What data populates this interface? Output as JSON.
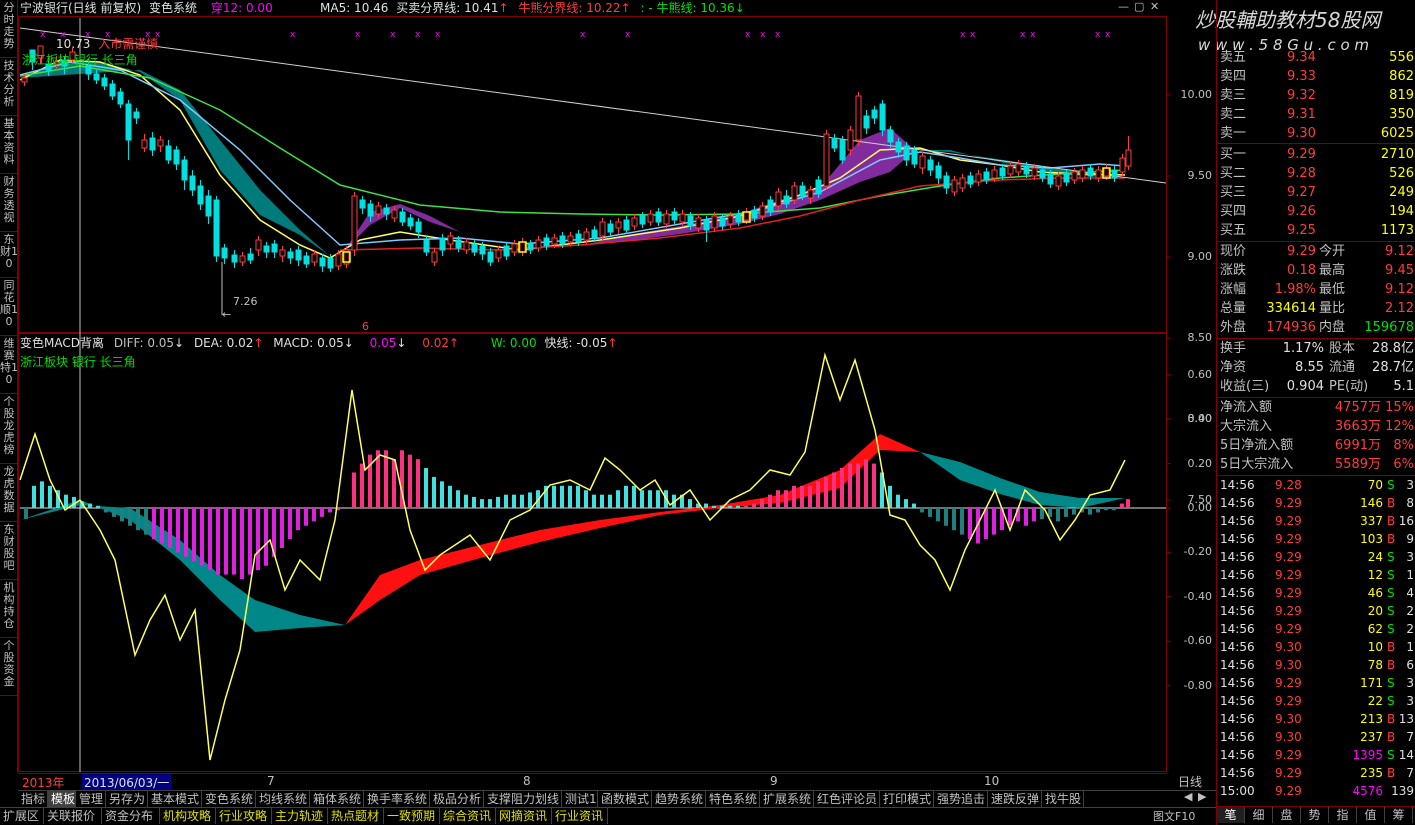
{
  "watermark": {
    "title": "炒股輔助教材58股网",
    "url": "w w w . 5 8 G u . c o m"
  },
  "window": {
    "minimize_glyph": "—",
    "restore_glyph": "▢",
    "close_glyph": "✕"
  },
  "left_tabs": [
    "分时走势",
    "技术分析",
    "基本资料",
    "财务透视",
    "东财10",
    "同花顺10",
    "维赛特10",
    "个股龙虎榜",
    "龙虎数据",
    "东财股吧",
    "机构持仓",
    "个股资金"
  ],
  "main_header": {
    "stock": "宁波银行(日线 前复权)",
    "system": "变色系统",
    "chuan": "穿12: 0.00",
    "ma5": "MA5: 10.46",
    "buysell": "买卖分界线: 10.41",
    "buysell_arrow": "↑",
    "bullbear": "牛熊分界线: 10.22",
    "bullbear_arrow": "↑",
    "bull_prefix": ": -",
    "bull": "牛熊线: 10.36",
    "bull_arrow": "↓"
  },
  "price_chart": {
    "overlay1": "10.73",
    "overlay2": "入市需谨慎",
    "sector": "浙江板块 银行 长三角",
    "low_label": "7.26",
    "axis": [
      {
        "label": "10.00",
        "value": 10.0
      },
      {
        "label": "9.50",
        "value": 9.5
      },
      {
        "label": "9.00",
        "value": 9.0
      },
      {
        "label": "8.50",
        "value": 8.5
      },
      {
        "label": "8.00",
        "value": 8.0
      },
      {
        "label": "7.50",
        "value": 7.5
      }
    ],
    "marker": "6"
  },
  "macd_header": {
    "name": "变色MACD背离",
    "diff": "DIFF: 0.05",
    "diff_arrow": "↓",
    "dea": "DEA: 0.02",
    "dea_arrow": "↑",
    "macd": "MACD: 0.05",
    "macd_arrow": "↓",
    "v1": "0.05",
    "v1_arrow": "↓",
    "v2": "0.02",
    "v2_arrow": "↑",
    "w": "W: 0.00",
    "fast": "快线: -0.05",
    "fast_arrow": "↑",
    "sector": "浙江板块 银行 长三角"
  },
  "macd_axis": [
    {
      "label": "0.60",
      "value": 0.6
    },
    {
      "label": "0.40",
      "value": 0.4
    },
    {
      "label": "0.20",
      "value": 0.2
    },
    {
      "label": "0.00",
      "value": 0.0
    },
    {
      "label": "-0.20",
      "value": -0.2
    },
    {
      "label": "-0.40",
      "value": -0.4
    },
    {
      "label": "-0.60",
      "value": -0.6
    },
    {
      "label": "-0.80",
      "value": -0.8
    }
  ],
  "date_axis": {
    "year": "2013年",
    "cursor": "2013/06/03/一",
    "months": [
      "7",
      "8",
      "9",
      "10"
    ],
    "period": "日线"
  },
  "order_book": [
    {
      "label": "卖五",
      "price": "9.34",
      "vol": "556"
    },
    {
      "label": "卖四",
      "price": "9.33",
      "vol": "862"
    },
    {
      "label": "卖三",
      "price": "9.32",
      "vol": "819"
    },
    {
      "label": "卖二",
      "price": "9.31",
      "vol": "350"
    },
    {
      "label": "卖一",
      "price": "9.30",
      "vol": "6025"
    },
    {
      "label": "买一",
      "price": "9.29",
      "vol": "2710"
    },
    {
      "label": "买二",
      "price": "9.28",
      "vol": "526"
    },
    {
      "label": "买三",
      "price": "9.27",
      "vol": "249"
    },
    {
      "label": "买四",
      "price": "9.26",
      "vol": "194"
    },
    {
      "label": "买五",
      "price": "9.25",
      "vol": "1173"
    }
  ],
  "quote": [
    {
      "l1": "现价",
      "v1": "9.29",
      "l2": "今开",
      "v2": "9.12"
    },
    {
      "l1": "涨跌",
      "v1": "0.18",
      "l2": "最高",
      "v2": "9.45"
    },
    {
      "l1": "涨幅",
      "v1": "1.98%",
      "l2": "最低",
      "v2": "9.12"
    },
    {
      "l1": "总量",
      "v1": "334614",
      "l2": "量比",
      "v2": "2.12"
    },
    {
      "l1": "外盘",
      "v1": "174936",
      "l2": "内盘",
      "v2": "159678"
    }
  ],
  "fundamentals": [
    {
      "l1": "换手",
      "v1": "1.17%",
      "l2": "股本",
      "v2": "28.8亿"
    },
    {
      "l1": "净资",
      "v1": "8.55",
      "l2": "流通",
      "v2": "28.7亿"
    },
    {
      "l1": "收益(三)",
      "v1": "0.904",
      "l2": "PE(动)",
      "v2": "5.1"
    }
  ],
  "flows": [
    {
      "label": "净流入额",
      "value": "4757万",
      "pct": "15%"
    },
    {
      "label": "大宗流入",
      "value": "3663万",
      "pct": "12%"
    },
    {
      "label": "5日净流入额",
      "value": "6991万",
      "pct": "8%"
    },
    {
      "label": "5日大宗流入",
      "value": "5589万",
      "pct": "6%"
    }
  ],
  "ticks": [
    {
      "time": "14:56",
      "price": "9.28",
      "vol": "70",
      "side": "S",
      "n": "3"
    },
    {
      "time": "14:56",
      "price": "9.29",
      "vol": "146",
      "side": "B",
      "n": "8"
    },
    {
      "time": "14:56",
      "price": "9.29",
      "vol": "337",
      "side": "B",
      "n": "16"
    },
    {
      "time": "14:56",
      "price": "9.29",
      "vol": "103",
      "side": "B",
      "n": "9"
    },
    {
      "time": "14:56",
      "price": "9.29",
      "vol": "24",
      "side": "S",
      "n": "3"
    },
    {
      "time": "14:56",
      "price": "9.29",
      "vol": "12",
      "side": "S",
      "n": "1"
    },
    {
      "time": "14:56",
      "price": "9.29",
      "vol": "46",
      "side": "S",
      "n": "4"
    },
    {
      "time": "14:56",
      "price": "9.29",
      "vol": "20",
      "side": "S",
      "n": "2"
    },
    {
      "time": "14:56",
      "price": "9.29",
      "vol": "62",
      "side": "S",
      "n": "2"
    },
    {
      "time": "14:56",
      "price": "9.30",
      "vol": "10",
      "side": "B",
      "n": "1"
    },
    {
      "time": "14:56",
      "price": "9.30",
      "vol": "78",
      "side": "B",
      "n": "6"
    },
    {
      "time": "14:56",
      "price": "9.29",
      "vol": "171",
      "side": "S",
      "n": "3"
    },
    {
      "time": "14:56",
      "price": "9.29",
      "vol": "22",
      "side": "S",
      "n": "3"
    },
    {
      "time": "14:56",
      "price": "9.30",
      "vol": "213",
      "side": "B",
      "n": "13"
    },
    {
      "time": "14:56",
      "price": "9.30",
      "vol": "237",
      "side": "B",
      "n": "7"
    },
    {
      "time": "14:56",
      "price": "9.29",
      "vol": "1395",
      "side": "S",
      "n": "14"
    },
    {
      "time": "14:56",
      "price": "9.29",
      "vol": "235",
      "side": "B",
      "n": "7"
    },
    {
      "time": "15:00",
      "price": "9.29",
      "vol": "4576",
      "side": "",
      "n": "139"
    }
  ],
  "toolbar1": [
    "指标",
    "模板",
    "管理",
    "另存为",
    "基本模式",
    "变色系统",
    "均线系统",
    "箱体系统",
    "换手率系统",
    "极品分析",
    "支撑阻力划线",
    "测试1",
    "函数模式",
    "趋势系统",
    "特色系统",
    "扩展系统",
    "红色评论员",
    "打印模式",
    "强势追击",
    "速跌反弹",
    "找牛股"
  ],
  "toolbar2": [
    "扩展区",
    "关联报价",
    "资金分布",
    "机构攻略",
    "行业攻略",
    "主力轨迹",
    "热点题材",
    "一致预期",
    "综合资讯",
    "网摘资讯",
    "行业资讯"
  ],
  "right_tabs": [
    "笔",
    "细",
    "盘",
    "势",
    "指",
    "值",
    "筹"
  ],
  "footer_label": "图文F10",
  "colors": {
    "up": "#ff3c3c",
    "down": "#00ffff",
    "frame": "#800000",
    "axis_text": "#c0c0c0"
  }
}
